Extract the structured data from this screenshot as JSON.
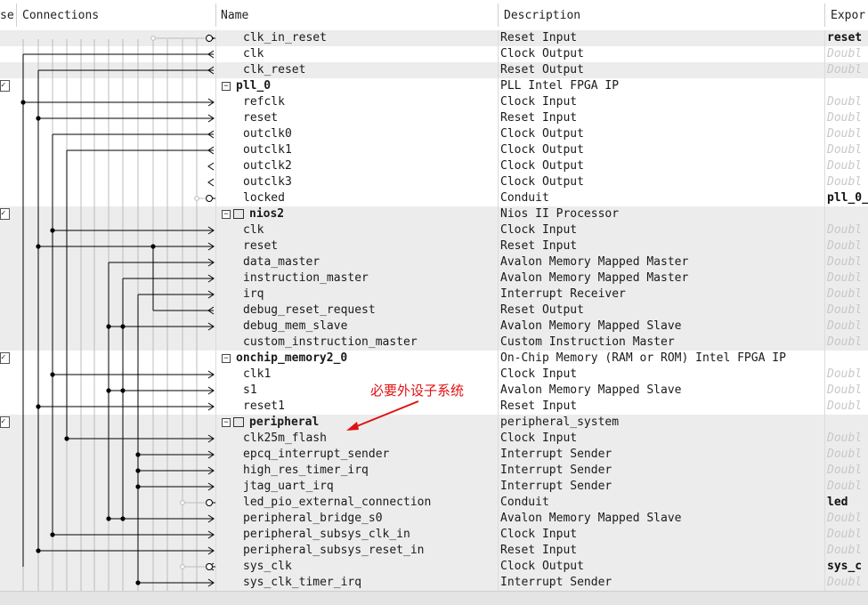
{
  "header": {
    "use_label": "se",
    "connections_label": "Connections",
    "name_label": "Name",
    "description_label": "Description",
    "export_label": "Expor"
  },
  "rows": [
    {
      "name": "clk_in_reset",
      "desc": "Reset Input",
      "export": "reset",
      "export_style": "bold",
      "gray": true
    },
    {
      "name": "clk",
      "desc": "Clock Output",
      "export": "Doubl",
      "export_style": "hint",
      "gray": false
    },
    {
      "name": "clk_reset",
      "desc": "Reset Output",
      "export": "Doubl",
      "export_style": "hint",
      "gray": true
    },
    {
      "name": "pll_0",
      "desc": "PLL Intel FPGA IP",
      "export": "",
      "top": true,
      "checked": true,
      "gray": false
    },
    {
      "name": "refclk",
      "desc": "Clock Input",
      "export": "Doubl",
      "export_style": "hint",
      "gray": false
    },
    {
      "name": "reset",
      "desc": "Reset Input",
      "export": "Doubl",
      "export_style": "hint",
      "gray": false
    },
    {
      "name": "outclk0",
      "desc": "Clock Output",
      "export": "Doubl",
      "export_style": "hint",
      "gray": false
    },
    {
      "name": "outclk1",
      "desc": "Clock Output",
      "export": "Doubl",
      "export_style": "hint",
      "gray": false
    },
    {
      "name": "outclk2",
      "desc": "Clock Output",
      "export": "Doubl",
      "export_style": "hint",
      "gray": false
    },
    {
      "name": "outclk3",
      "desc": "Clock Output",
      "export": "Doubl",
      "export_style": "hint",
      "gray": false
    },
    {
      "name": "locked",
      "desc": "Conduit",
      "export": "pll_0_",
      "export_style": "bold",
      "gray": false
    },
    {
      "name": "nios2",
      "desc": "Nios II Processor",
      "export": "",
      "top": true,
      "checked": true,
      "cpu": true,
      "gray": true
    },
    {
      "name": "clk",
      "desc": "Clock Input",
      "export": "Doubl",
      "export_style": "hint",
      "gray": true
    },
    {
      "name": "reset",
      "desc": "Reset Input",
      "export": "Doubl",
      "export_style": "hint",
      "gray": true
    },
    {
      "name": "data_master",
      "desc": "Avalon Memory Mapped Master",
      "export": "Doubl",
      "export_style": "hint",
      "gray": true
    },
    {
      "name": "instruction_master",
      "desc": "Avalon Memory Mapped Master",
      "export": "Doubl",
      "export_style": "hint",
      "gray": true
    },
    {
      "name": "irq",
      "desc": "Interrupt Receiver",
      "export": "Doubl",
      "export_style": "hint",
      "gray": true
    },
    {
      "name": "debug_reset_request",
      "desc": "Reset Output",
      "export": "Doubl",
      "export_style": "hint",
      "gray": true
    },
    {
      "name": "debug_mem_slave",
      "desc": "Avalon Memory Mapped Slave",
      "export": "Doubl",
      "export_style": "hint",
      "gray": true
    },
    {
      "name": "custom_instruction_master",
      "desc": "Custom Instruction Master",
      "export": "Doubl",
      "export_style": "hint",
      "gray": true
    },
    {
      "name": "onchip_memory2_0",
      "desc": "On-Chip Memory (RAM or ROM) Intel FPGA IP",
      "export": "",
      "top": true,
      "checked": true,
      "gray": false
    },
    {
      "name": "clk1",
      "desc": "Clock Input",
      "export": "Doubl",
      "export_style": "hint",
      "gray": false
    },
    {
      "name": "s1",
      "desc": "Avalon Memory Mapped Slave",
      "export": "Doubl",
      "export_style": "hint",
      "gray": false
    },
    {
      "name": "reset1",
      "desc": "Reset Input",
      "export": "Doubl",
      "export_style": "hint",
      "gray": false
    },
    {
      "name": "peripheral",
      "desc": "peripheral_system",
      "export": "",
      "top": true,
      "checked": true,
      "cpu": true,
      "gray": true
    },
    {
      "name": "clk25m_flash",
      "desc": "Clock Input",
      "export": "Doubl",
      "export_style": "hint",
      "gray": true
    },
    {
      "name": "epcq_interrupt_sender",
      "desc": "Interrupt Sender",
      "export": "Doubl",
      "export_style": "hint",
      "gray": true
    },
    {
      "name": "high_res_timer_irq",
      "desc": "Interrupt Sender",
      "export": "Doubl",
      "export_style": "hint",
      "gray": true
    },
    {
      "name": "jtag_uart_irq",
      "desc": "Interrupt Sender",
      "export": "Doubl",
      "export_style": "hint",
      "gray": true
    },
    {
      "name": "led_pio_external_connection",
      "desc": "Conduit",
      "export": "led",
      "export_style": "bold",
      "gray": true
    },
    {
      "name": "peripheral_bridge_s0",
      "desc": "Avalon Memory Mapped Slave",
      "export": "Doubl",
      "export_style": "hint",
      "gray": true
    },
    {
      "name": "peripheral_subsys_clk_in",
      "desc": "Clock Input",
      "export": "Doubl",
      "export_style": "hint",
      "gray": true
    },
    {
      "name": "peripheral_subsys_reset_in",
      "desc": "Reset Input",
      "export": "Doubl",
      "export_style": "hint",
      "gray": true
    },
    {
      "name": "sys_clk",
      "desc": "Clock Output",
      "export": "sys_c",
      "export_style": "bold",
      "gray": true
    },
    {
      "name": "sys_clk_timer_irq",
      "desc": "Interrupt Sender",
      "export": "Doubl",
      "export_style": "hint",
      "gray": true
    }
  ],
  "annotation": {
    "text": "必要外设子系统",
    "color": "#e01010"
  },
  "colors": {
    "row_gray": "#ececec",
    "wire": "#000000",
    "wire_light": "#bdbdbd",
    "hint_text": "#c8c8c8"
  }
}
